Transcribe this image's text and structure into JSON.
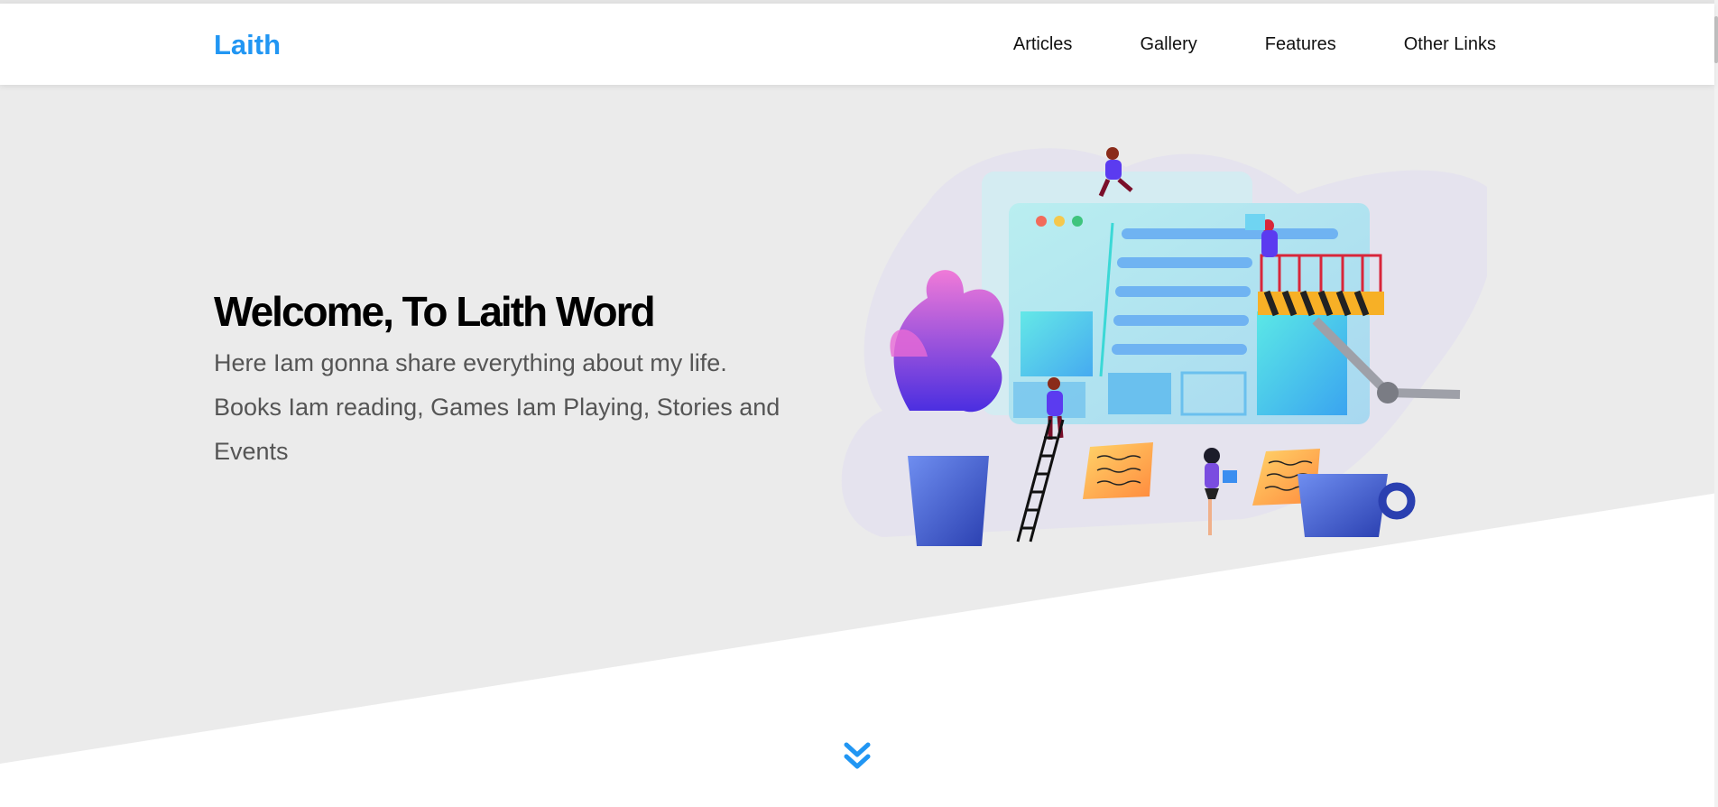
{
  "header": {
    "logo": "Laith",
    "nav": [
      "Articles",
      "Gallery",
      "Features",
      "Other Links"
    ]
  },
  "hero": {
    "title": "Welcome, To Laith Word",
    "description": "Here Iam gonna share everything about my life. Books Iam reading, Games Iam Playing, Stories and Events"
  },
  "icons": {
    "scroll": "double-chevron-down-icon"
  },
  "colors": {
    "accent": "#2196f3",
    "hero_background": "#ebebeb",
    "heading": "#000000",
    "body_text": "#555555"
  }
}
